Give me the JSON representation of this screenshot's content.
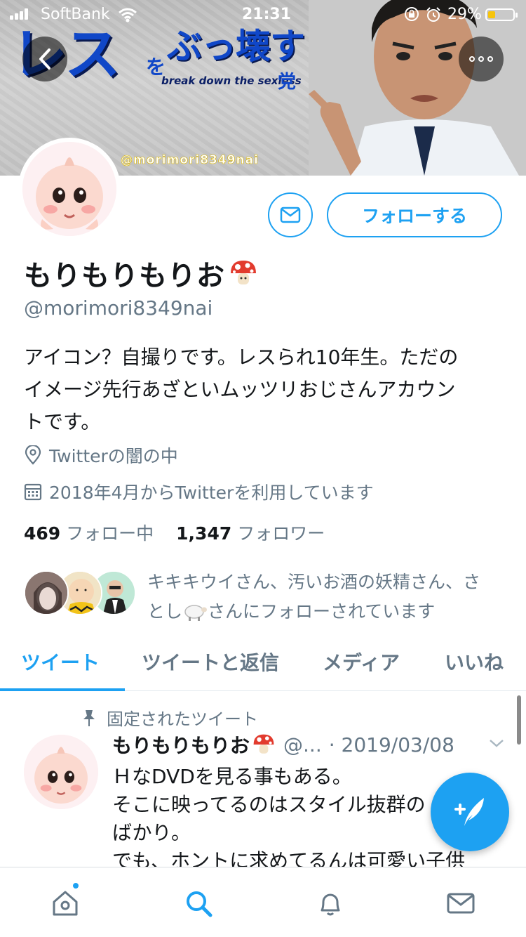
{
  "status_bar": {
    "carrier": "SoftBank",
    "time": "21:31",
    "battery_percent": "29%",
    "battery_level": 0.29
  },
  "banner": {
    "title_big": "レス",
    "title_wo": "を",
    "title_small": "ぶっ壊す",
    "subtitle": "break down the sexless",
    "party": "党",
    "handle": "@morimori8349nai"
  },
  "profile": {
    "display_name": "もりもりもりお",
    "name_emoji": "mushroom-icon",
    "handle": "@morimori8349nai",
    "bio_lines": [
      "アイコン？自撮りです。レスられ10年生。ただの",
      "イメージ先行あざといムッツリおじさんアカウン",
      "トです。"
    ],
    "location": "Twitterの闇の中",
    "joined": "2018年4月からTwitterを利用しています",
    "following_count": "469",
    "following_label": "フォロー中",
    "followers_count": "1,347",
    "followers_label": "フォロワー",
    "follow_button": "フォローする",
    "followed_by_line1": "キキキウイさん、汚いお酒の妖精さん、さ",
    "followed_by_line2_a": "とし",
    "followed_by_line2_b": "さんにフォローされています"
  },
  "tabs": [
    {
      "label": "ツイート",
      "active": true
    },
    {
      "label": "ツイートと返信",
      "active": false
    },
    {
      "label": "メディア",
      "active": false
    },
    {
      "label": "いいね",
      "active": false
    }
  ],
  "pinned_tweet": {
    "pinned_label": "固定されたツイート",
    "name": "もりもりもりお",
    "handle": "@...",
    "date": "· 2019/03/08",
    "lines": [
      "ＨなDVDを見る事もある。",
      "そこに映ってるのはスタイル抜群の",
      "ばかり。",
      "でも、ホントに求めてるんは可愛い子供"
    ]
  },
  "colors": {
    "accent": "#1da1f2",
    "secondary_text": "#657786",
    "banner_blue": "#1047c8"
  }
}
